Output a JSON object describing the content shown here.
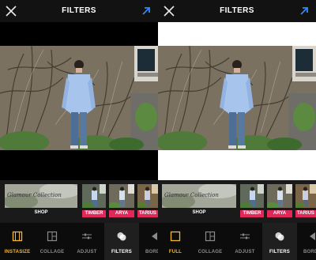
{
  "screens": [
    {
      "title": "FILTERS",
      "shop_label": "SHOP",
      "shop_thumb_text": "Glamour Collection",
      "filters": [
        "TIMBER",
        "ARYA",
        "TARIUS"
      ],
      "tools": [
        "INSTASIZE",
        "COLLAGE",
        "ADJUST",
        "FILTERS",
        "BORD"
      ],
      "active_tool": "INSTASIZE",
      "canvas_background": "#000000"
    },
    {
      "title": "FILTERS",
      "shop_label": "SHOP",
      "shop_thumb_text": "Glamour Collection",
      "filters": [
        "TIMBER",
        "ARYA",
        "TARIUS"
      ],
      "tools": [
        "FULL",
        "COLLAGE",
        "ADJUST",
        "FILTERS",
        "BORD"
      ],
      "active_tool": "FULL",
      "canvas_background": "#ffffff"
    }
  ],
  "icons": {
    "close": "close-icon",
    "export": "export-arrow-icon",
    "tool_icons": [
      "crop-frame-icon",
      "collage-icon",
      "adjust-sliders-icon",
      "filters-circles-icon",
      "border-icon"
    ]
  },
  "colors": {
    "accent_gold": "#f5b731",
    "filter_label": "#e0285a",
    "export_blue": "#2a8cff"
  }
}
